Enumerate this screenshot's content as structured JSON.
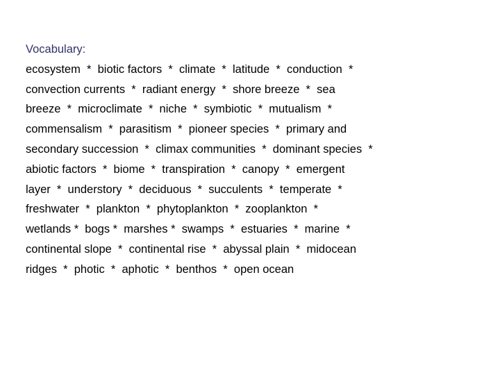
{
  "slide": {
    "background_color": "#ffffff",
    "heading": {
      "text": "Vocabulary:",
      "color": "#333366"
    },
    "body": {
      "color": "#000000",
      "separator": "*",
      "lines": [
        "ecosystem  *  biotic factors  *  climate  *  latitude  *  conduction  *",
        "convection currents  *  radiant energy  *  shore breeze  *  sea",
        "breeze  *  microclimate  *  niche  *  symbiotic  *  mutualism  *",
        "commensalism  *  parasitism  *  pioneer species  *  primary and",
        "secondary succession  *  climax communities  *  dominant species  *",
        "abiotic factors  *  biome  *  transpiration  *  canopy  *  emergent",
        "layer  *  understory  *  deciduous  *  succulents  *  temperate  *",
        "freshwater  *  plankton  *  phytoplankton  *  zooplankton  *",
        "wetlands *  bogs *  marshes *  swamps  *  estuaries  *  marine  *",
        "continental slope  *  continental rise  *  abyssal plain  *  midocean",
        "ridges  *  photic  *  aphotic  *  benthos  *  open ocean"
      ],
      "terms": [
        "ecosystem",
        "biotic factors",
        "climate",
        "latitude",
        "conduction",
        "convection currents",
        "radiant energy",
        "shore breeze",
        "sea breeze",
        "microclimate",
        "niche",
        "symbiotic",
        "mutualism",
        "commensalism",
        "parasitism",
        "pioneer species",
        "primary and secondary succession",
        "climax communities",
        "dominant species",
        "abiotic factors",
        "biome",
        "transpiration",
        "canopy",
        "emergent layer",
        "understory",
        "deciduous",
        "succulents",
        "temperate",
        "freshwater",
        "plankton",
        "phytoplankton",
        "zooplankton",
        "wetlands",
        "bogs",
        "marshes",
        "swamps",
        "estuaries",
        "marine",
        "continental slope",
        "continental rise",
        "abyssal plain",
        "midocean ridges",
        "photic",
        "aphotic",
        "benthos",
        "open ocean"
      ]
    }
  }
}
